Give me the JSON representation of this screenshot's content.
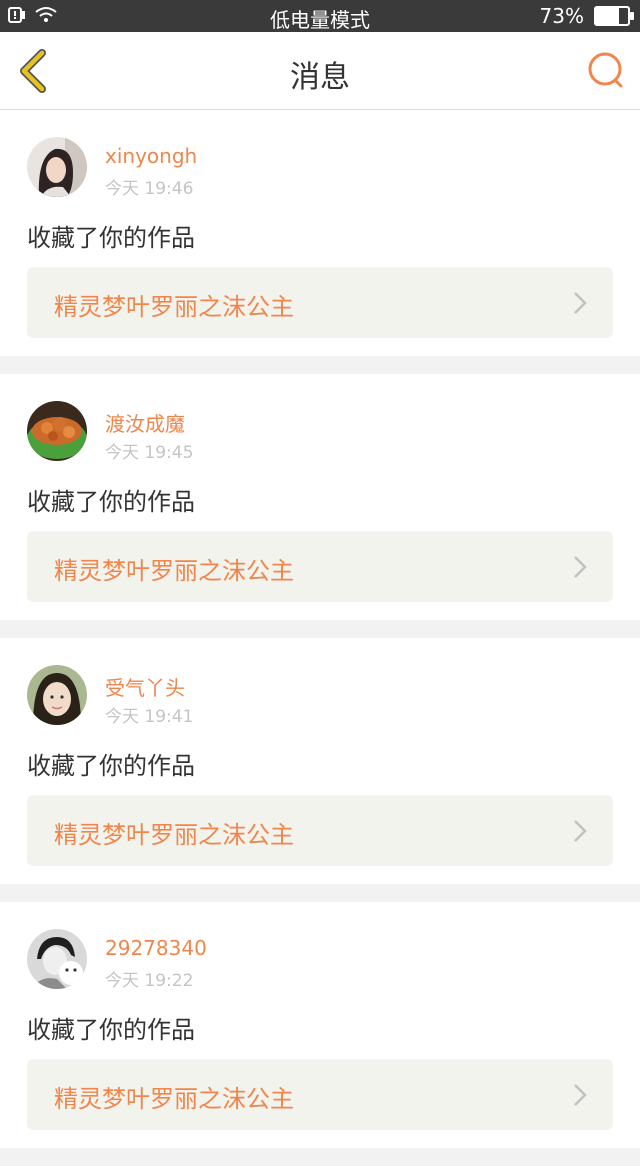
{
  "status_bar": {
    "mode": "低电量模式",
    "battery": "73%",
    "battery_level": 0.73
  },
  "header": {
    "title": "消息"
  },
  "colors": {
    "accent": "#f0864b",
    "back_icon": "#e6c321"
  },
  "icons": {
    "back": "chevron-left-icon",
    "search": "search-icon",
    "row": "chevron-right-icon"
  },
  "messages": [
    {
      "username": "xinyongh",
      "time": "今天 19:46",
      "action": "收藏了你的作品",
      "work_title": "精灵梦叶罗丽之沫公主"
    },
    {
      "username": "渡汝成魔",
      "time": "今天 19:45",
      "action": "收藏了你的作品",
      "work_title": "精灵梦叶罗丽之沫公主"
    },
    {
      "username": "受气丫头",
      "time": "今天 19:41",
      "action": "收藏了你的作品",
      "work_title": "精灵梦叶罗丽之沫公主"
    },
    {
      "username": "29278340",
      "time": "今天 19:22",
      "action": "收藏了你的作品",
      "work_title": "精灵梦叶罗丽之沫公主"
    }
  ]
}
